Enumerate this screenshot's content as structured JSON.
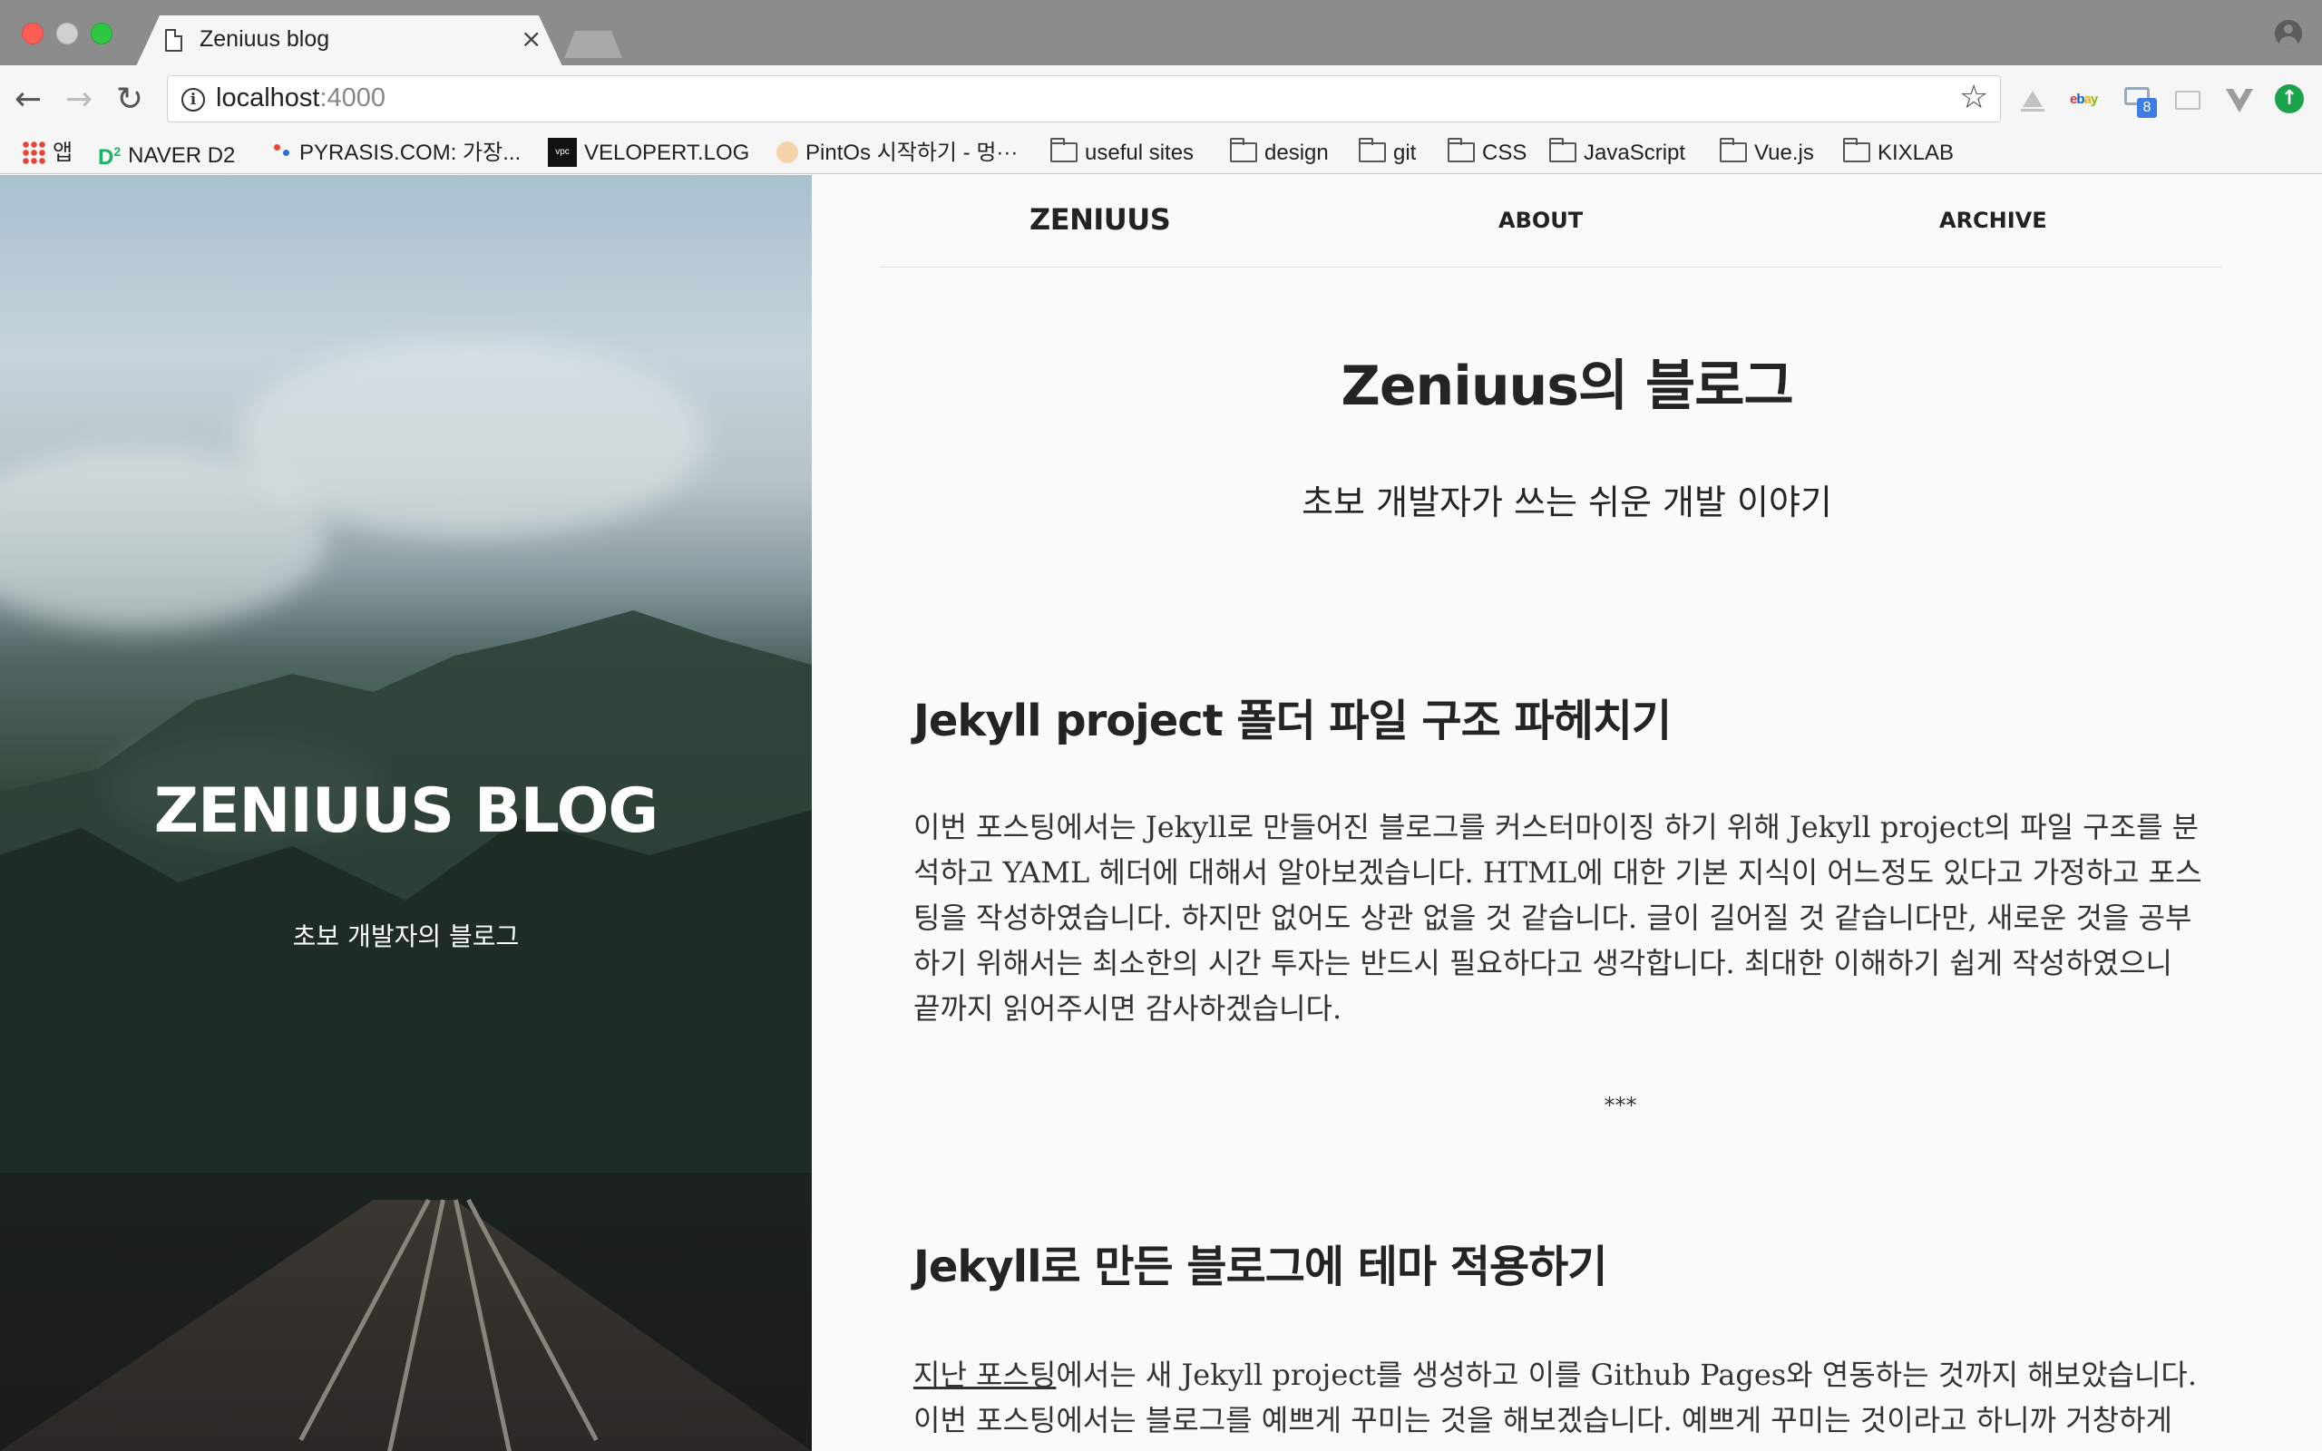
{
  "browser": {
    "tab_title": "Zeniuus blog",
    "tab_close": "×",
    "url_host": "localhost",
    "url_port": ":4000",
    "extension_badge": "8",
    "bookmarks": [
      {
        "label": "앱",
        "icon": "apps-icon"
      },
      {
        "label": "NAVER D2",
        "icon": "d2-icon"
      },
      {
        "label": "PYRASIS.COM: 가장...",
        "icon": "pyrasis-icon"
      },
      {
        "label": "VELOPERT.LOG",
        "icon": "velopert-icon"
      },
      {
        "label": "PintOs 시작하기 - 멍···",
        "icon": "pintos-icon"
      },
      {
        "label": "useful sites",
        "icon": "folder-icon"
      },
      {
        "label": "design",
        "icon": "folder-icon"
      },
      {
        "label": "git",
        "icon": "folder-icon"
      },
      {
        "label": "CSS",
        "icon": "folder-icon"
      },
      {
        "label": "JavaScript",
        "icon": "folder-icon"
      },
      {
        "label": "Vue.js",
        "icon": "folder-icon"
      },
      {
        "label": "KIXLAB",
        "icon": "folder-icon"
      }
    ]
  },
  "sidebar": {
    "title": "ZENIUUS BLOG",
    "subtitle": "초보 개발자의 블로그"
  },
  "nav": {
    "brand": "ZENIUUS",
    "about": "ABOUT",
    "archive": "ARCHIVE"
  },
  "header": {
    "title": "Zeniuus의 블로그",
    "description": "초보 개발자가 쓰는 쉬운 개발 이야기"
  },
  "posts": [
    {
      "title": "Jekyll project 폴더 파일 구조 파헤치기",
      "excerpt": "이번 포스팅에서는 Jekyll로 만들어진 블로그를 커스터마이징 하기 위해 Jekyll project의 파일 구조를 분석하고 YAML 헤더에 대해서 알아보겠습니다. HTML에 대한 기본 지식이 어느정도 있다고 가정하고 포스팅을 작성하였습니다. 하지만 없어도 상관 없을 것 같습니다. 글이 길어질 것 같습니다만, 새로운 것을 공부하기 위해서는 최소한의 시간 투자는 반드시 필요하다고 생각합니다. 최대한 이해하기 쉽게 작성하였으니 끝까지 읽어주시면 감사하겠습니다."
    },
    {
      "title": "Jekyll로 만든 블로그에 테마 적용하기",
      "excerpt_link": "지난 포스팅",
      "excerpt": "에서는 새 Jekyll project를 생성하고 이를 Github Pages와 연동하는 것까지 해보았습니다. 이번 포스팅에서는 블로그를 예쁘게 꾸미는 것을 해보겠습니다. 예쁘게 꾸미는 것이라고 하니까 거창하게 들리"
    }
  ],
  "separator": "***"
}
